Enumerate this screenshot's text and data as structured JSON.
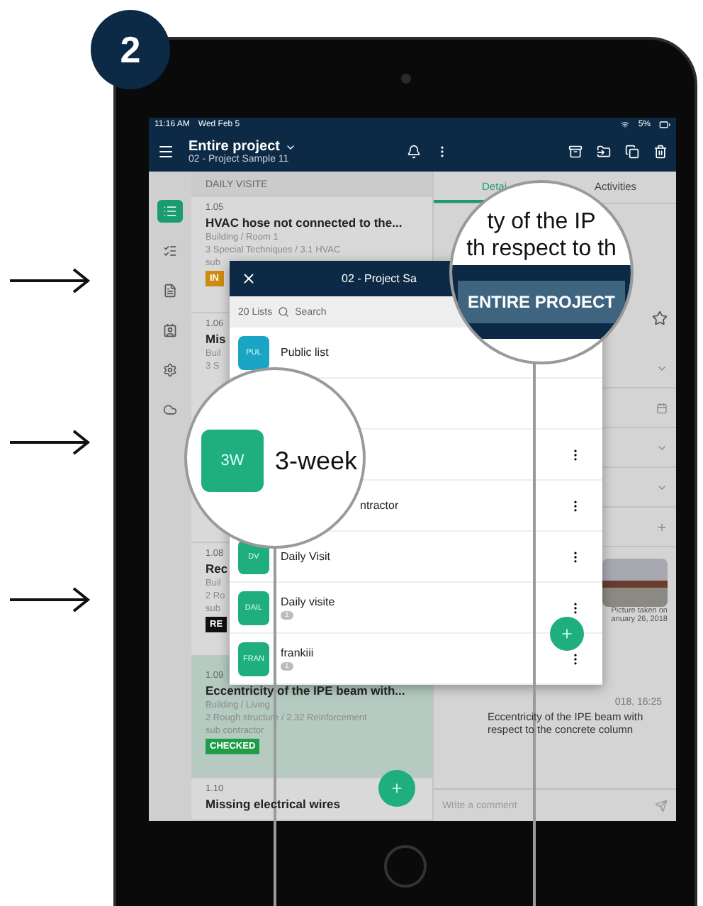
{
  "badge": "2",
  "status_bar": {
    "time": "11:16 AM",
    "date": "Wed Feb 5",
    "battery": "5%"
  },
  "app_bar": {
    "title": "Entire project",
    "subtitle": "02 - Project Sample 11"
  },
  "rail": [
    {
      "selected": true
    },
    {
      "selected": false
    },
    {
      "selected": false
    },
    {
      "selected": false
    },
    {
      "selected": false
    },
    {
      "selected": false
    }
  ],
  "list": {
    "header": "DAILY VISITE",
    "items": [
      {
        "number": "1.05",
        "title": "HVAC hose not connected to the...",
        "lines": [
          "Building / Room 1",
          "3 Special Techniques / 3.1 HVAC",
          "sub"
        ],
        "status": {
          "label": "IN",
          "kind": "in_progress"
        },
        "highlighted": false
      },
      {
        "number": "1.06",
        "title": "Mis",
        "lines": [
          "Buil",
          "3 S"
        ],
        "highlighted": false
      },
      {
        "highlighted": false
      },
      {
        "number": "1.08",
        "title": "Rec",
        "lines": [
          "Buil",
          "2 Ro",
          "sub"
        ],
        "status": {
          "label": "RE",
          "kind": "review"
        },
        "highlighted": false
      },
      {
        "number": "1.09",
        "title": "Eccentricity of the IPE beam with...",
        "lines": [
          "Building / Living",
          "2 Rough structure / 2.32 Reinforcement",
          "sub contractor"
        ],
        "status": {
          "label": "CHECKED",
          "kind": "checked"
        },
        "highlighted": true
      },
      {
        "number": "1.10",
        "title": "Missing electrical wires",
        "highlighted": false
      }
    ]
  },
  "detail": {
    "tabs": [
      {
        "label": "Detai",
        "selected": true
      },
      {
        "label": "Activities",
        "selected": false
      }
    ],
    "fields": [
      {
        "kind": "dropdown"
      },
      {
        "kind": "date"
      },
      {
        "kind": "dropdown"
      },
      {
        "kind": "dropdown"
      },
      {
        "kind": "add"
      }
    ],
    "photo_caption": [
      "Picture taken on",
      "anuary 26, 2018"
    ],
    "activity": {
      "date": "018, 16:25",
      "text": "Eccentricity of the IPE beam with respect to the concrete column"
    },
    "comment_placeholder": "Write a comment"
  },
  "dialog": {
    "title": "02 - Project Sa",
    "count": "20 Lists",
    "search_placeholder": "Search",
    "rows": [
      {
        "badge": "PUL",
        "label": "Public list",
        "color": "#1ba5c4",
        "menu": false
      },
      {
        "menu": false
      },
      {
        "menu": true
      },
      {
        "label": "ntractor",
        "menu": true
      },
      {
        "badge": "DV",
        "label": "Daily Visit",
        "color": "#1fae7e",
        "menu": true
      },
      {
        "badge": "DAIL",
        "label": "Daily visite",
        "count": "1",
        "color": "#1fae7e",
        "menu": true
      },
      {
        "badge": "FRAN",
        "label": "frankiii",
        "count": "1",
        "color": "#1fae7e",
        "menu": true
      }
    ]
  },
  "magnifiers": [
    {
      "kind": "list_row",
      "badge": "3W",
      "label": "3-week"
    },
    {
      "kind": "header",
      "lines": [
        "ty of the IP",
        "th respect to th"
      ],
      "button": "ENTIRE PROJECT"
    }
  ]
}
